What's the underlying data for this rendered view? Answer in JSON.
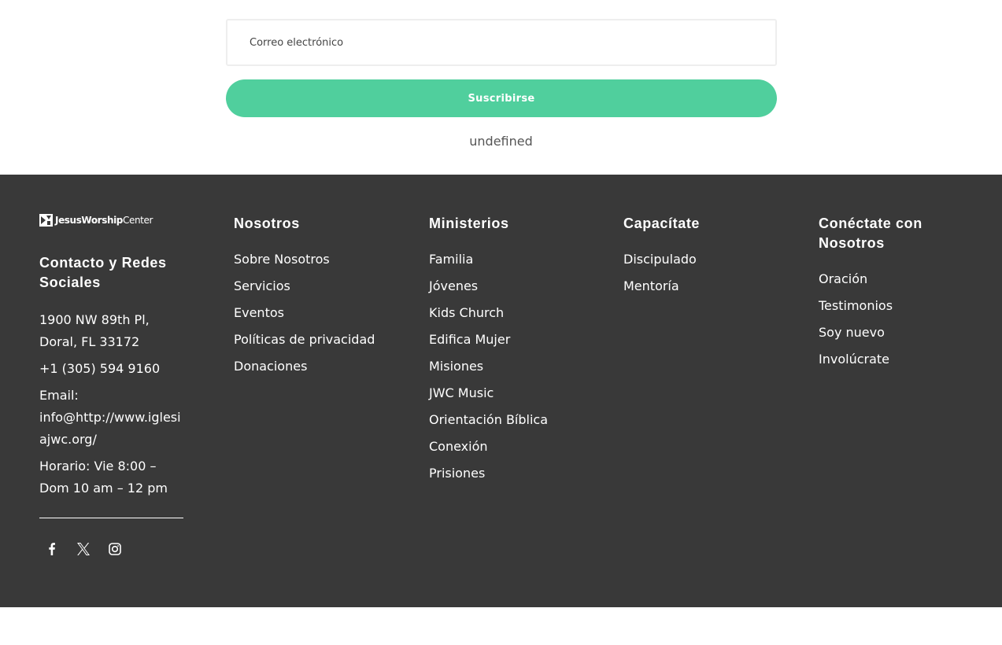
{
  "newsletter": {
    "email_placeholder": "Correo electrónico",
    "subscribe_label": "Suscribirse",
    "result_message": "undefined",
    "accent_color": "#50cf9d"
  },
  "footer": {
    "background_color": "#393939",
    "logo": {
      "text_bold": "JesusWorship",
      "text_thin": "Center"
    },
    "contact": {
      "heading": "Contacto y Redes Sociales",
      "address": "1900 NW 89th Pl, Doral, FL 33172",
      "phone": "+1 (305) 594 9160",
      "email_label": "Email:",
      "email": "info@http://www.iglesiajwc.org/",
      "hours": "Horario: Vie 8:00 – Dom 10 am – 12 pm",
      "social": [
        "facebook-icon",
        "x-twitter-icon",
        "instagram-icon"
      ]
    },
    "nosotros": {
      "heading": "Nosotros",
      "links": [
        "Sobre Nosotros",
        "Servicios",
        "Eventos",
        "Políticas de privacidad",
        "Donaciones"
      ]
    },
    "ministerios": {
      "heading": "Ministerios",
      "links": [
        "Familia",
        "Jóvenes",
        "Kids Church",
        "Edifica Mujer",
        "Misiones",
        "JWC Music",
        "Orientación Bíblica",
        "Conexión",
        "Prisiones"
      ]
    },
    "capacitate": {
      "heading": "Capacítate",
      "links": [
        "Discipulado",
        "Mentoría"
      ]
    },
    "conectate": {
      "heading": "Conéctate con Nosotros",
      "links": [
        "Oración",
        "Testimonios",
        "Soy nuevo",
        "Involúcrate"
      ]
    }
  }
}
